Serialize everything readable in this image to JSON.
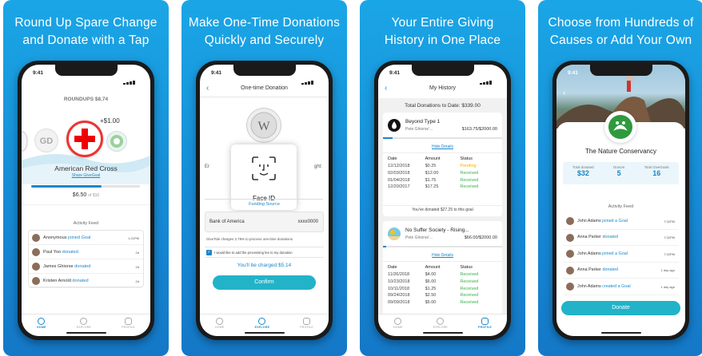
{
  "panels": [
    {
      "caption_l1": "Round Up Spare Change",
      "caption_l2": "and Donate with a Tap"
    },
    {
      "caption_l1": "Make One-Time Donations",
      "caption_l2": "Quickly and Securely"
    },
    {
      "caption_l1": "Your Entire Giving",
      "caption_l2": "History in One Place"
    },
    {
      "caption_l1": "Choose from Hundreds of",
      "caption_l2": "Causes or Add Your Own"
    }
  ],
  "status_time": "9:41",
  "tabs": {
    "home": "HOME",
    "explore": "EXPLORE",
    "profile": "PROFILE"
  },
  "screen1": {
    "roundups": "ROUNDUPS $8.74",
    "plus": "+$1.00",
    "gd_badge": "GD",
    "org_name": "American Red Cross",
    "share": "Share GiveGoal",
    "progress_amount": "$6.50",
    "progress_of": "of $10",
    "progress": 0.65,
    "activity_title": "Activity Feed",
    "feed": [
      {
        "name": "Anonymous",
        "action": "joined Goal",
        "time": "1:21PM"
      },
      {
        "name": "Paul Yoo",
        "action": "donated",
        "time": "2d"
      },
      {
        "name": "James Ghiorse",
        "action": "donated",
        "time": "2d"
      },
      {
        "name": "Kristen Arnold",
        "action": "donated",
        "time": "2d"
      }
    ]
  },
  "screen2": {
    "title": "One-time Donation",
    "faceid": "Face ID",
    "left_snip": "Er",
    "right_snip": "ght:",
    "funding_source": "Funding Source",
    "bank": "Bank of America",
    "acct": "xxxx0000",
    "fee_note": "GiveTide charges 2.79% to process one-time donations.",
    "checkbox_label": "I would like to add the processing fee to my donation",
    "charged": "You'll be charged $5.14",
    "confirm": "Confirm"
  },
  "screen3": {
    "title": "My History",
    "total": "Total Donations to Date: $339.00",
    "hide": "Hide Details",
    "headers": [
      "Date",
      "Amount",
      "Status"
    ],
    "card1": {
      "name": "Beyond Type 1",
      "sub": "Pete Ghiorse'...",
      "amount": "$163.75/$2000.00",
      "progress": 0.08,
      "rows": [
        [
          "12/12/2018",
          "$0.25",
          "Pending"
        ],
        [
          "02/03/2018",
          "$12.00",
          "Received"
        ],
        [
          "01/04/2018",
          "$1.75",
          "Received"
        ],
        [
          "12/20/2017",
          "$17.25",
          "Received"
        ]
      ],
      "note": "You've donated $27.25 to this goal"
    },
    "card2": {
      "name": "No Suffer Society - Rising...",
      "sub": "Pete Ghiorse'...",
      "amount": "$66.00/$2000.00",
      "progress": 0.03,
      "rows": [
        [
          "11/26/2018",
          "$4.00",
          "Received"
        ],
        [
          "10/23/2018",
          "$6.00",
          "Received"
        ],
        [
          "10/11/2018",
          "$1.25",
          "Received"
        ],
        [
          "09/24/2018",
          "$2.50",
          "Received"
        ],
        [
          "09/09/2018",
          "$5.00",
          "Received"
        ]
      ]
    }
  },
  "screen4": {
    "org_name": "The Nature Conservancy",
    "stats": [
      {
        "label": "Total donated",
        "value": "$32"
      },
      {
        "label": "Donors",
        "value": "5"
      },
      {
        "label": "Total GiveGoals",
        "value": "16"
      }
    ],
    "activity_title": "Activity Feed",
    "feed": [
      {
        "name": "John Adams",
        "action": "joined a Goal",
        "time": "7:32PM"
      },
      {
        "name": "Anna Parker",
        "action": "donated",
        "time": "7:32PM"
      },
      {
        "name": "John Adams",
        "action": "joined a Goal",
        "time": "7:32PM"
      },
      {
        "name": "Anna Parker",
        "action": "donated",
        "time": "1 day ago"
      },
      {
        "name": "John Adams",
        "action": "created a Goal",
        "time": "1 day ago"
      }
    ],
    "donate": "Donate"
  },
  "colors": {
    "accent": "#1b86c9",
    "teal": "#22b3c9",
    "received": "#38b24a",
    "pending": "#f0b000"
  }
}
